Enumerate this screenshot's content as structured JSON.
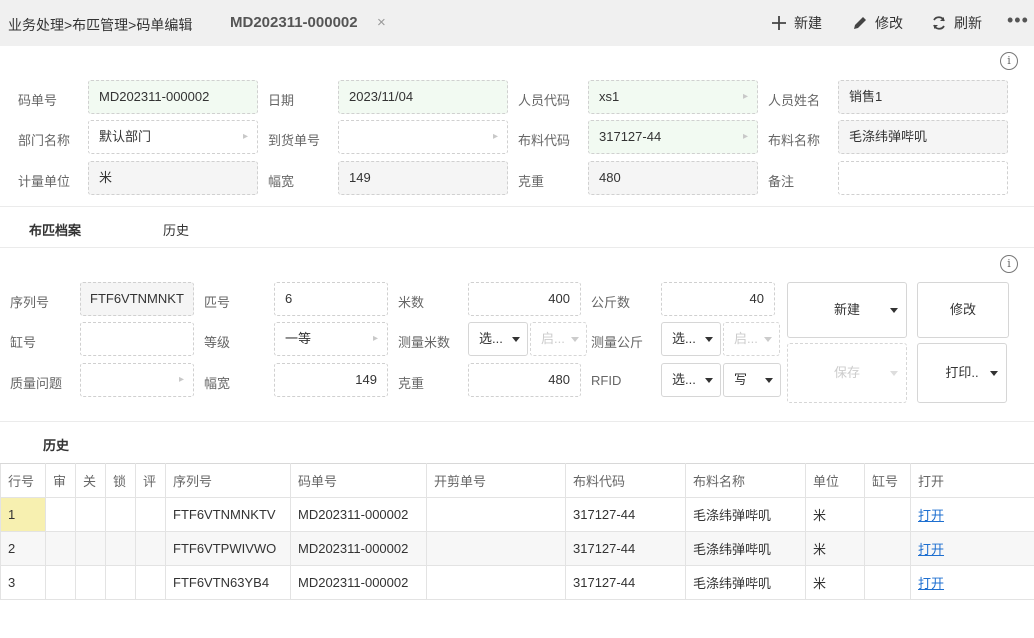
{
  "header": {
    "breadcrumb": "业务处理>布匹管理>码单编辑",
    "doc_title": "MD202311-000002",
    "close": "×",
    "new_label": "新建",
    "edit_label": "修改",
    "refresh_label": "刷新",
    "more": "•••"
  },
  "info_icon": "i",
  "form": {
    "code_label": "码单号",
    "code_value": "MD202311-000002",
    "date_label": "日期",
    "date_value": "2023/11/04",
    "staff_code_label": "人员代码",
    "staff_code_value": "xs1",
    "staff_name_label": "人员姓名",
    "staff_name_value": "销售1",
    "dept_label": "部门名称",
    "dept_value": "默认部门",
    "arrival_label": "到货单号",
    "arrival_value": "",
    "fabric_code_label": "布料代码",
    "fabric_code_value": "317127-44",
    "fabric_name_label": "布料名称",
    "fabric_name_value": "毛涤纬弹哔叽",
    "unit_label": "计量单位",
    "unit_value": "米",
    "width_label": "幅宽",
    "width_value": "149",
    "weight_label": "克重",
    "weight_value": "480",
    "remark_label": "备注",
    "remark_value": ""
  },
  "tabs": {
    "archive": "布匹档案",
    "history": "历史"
  },
  "roll": {
    "serial_label": "序列号",
    "serial_value": "FTF6VTNMNKT",
    "piece_label": "匹号",
    "piece_value": "6",
    "meters_label": "米数",
    "meters_value": "400",
    "kg_label": "公斤数",
    "kg_value": "40",
    "vat_label": "缸号",
    "vat_value": "",
    "grade_label": "等级",
    "grade_value": "一等",
    "measure_m_label": "测量米数",
    "measure_m_select": "选...",
    "measure_m_start": "启...",
    "measure_kg_label": "测量公斤",
    "measure_kg_select": "选...",
    "measure_kg_start": "启...",
    "quality_label": "质量问题",
    "quality_value": "",
    "width_label": "幅宽",
    "width_value": "149",
    "weight_label": "克重",
    "weight_value": "480",
    "rfid_label": "RFID",
    "rfid_select": "选...",
    "rfid_write": "写",
    "new_btn": "新建",
    "edit_btn": "修改",
    "save_btn": "保存",
    "print_btn": "打印.."
  },
  "history_title": "历史",
  "table": {
    "headers": [
      "行号",
      "审",
      "关",
      "锁",
      "评",
      "序列号",
      "码单号",
      "开剪单号",
      "布料代码",
      "布料名称",
      "单位",
      "缸号",
      "打开"
    ],
    "rows": [
      [
        "1",
        "",
        "",
        "",
        "",
        "FTF6VTNMNKTV",
        "MD202311-000002",
        "",
        "317127-44",
        "毛涤纬弹哔叽",
        "米",
        "",
        "打开"
      ],
      [
        "2",
        "",
        "",
        "",
        "",
        "FTF6VTPWIVWO",
        "MD202311-000002",
        "",
        "317127-44",
        "毛涤纬弹哔叽",
        "米",
        "",
        "打开"
      ],
      [
        "3",
        "",
        "",
        "",
        "",
        "FTF6VTN63YB4",
        "MD202311-000002",
        "",
        "317127-44",
        "毛涤纬弹哔叽",
        "米",
        "",
        "打开"
      ]
    ]
  }
}
